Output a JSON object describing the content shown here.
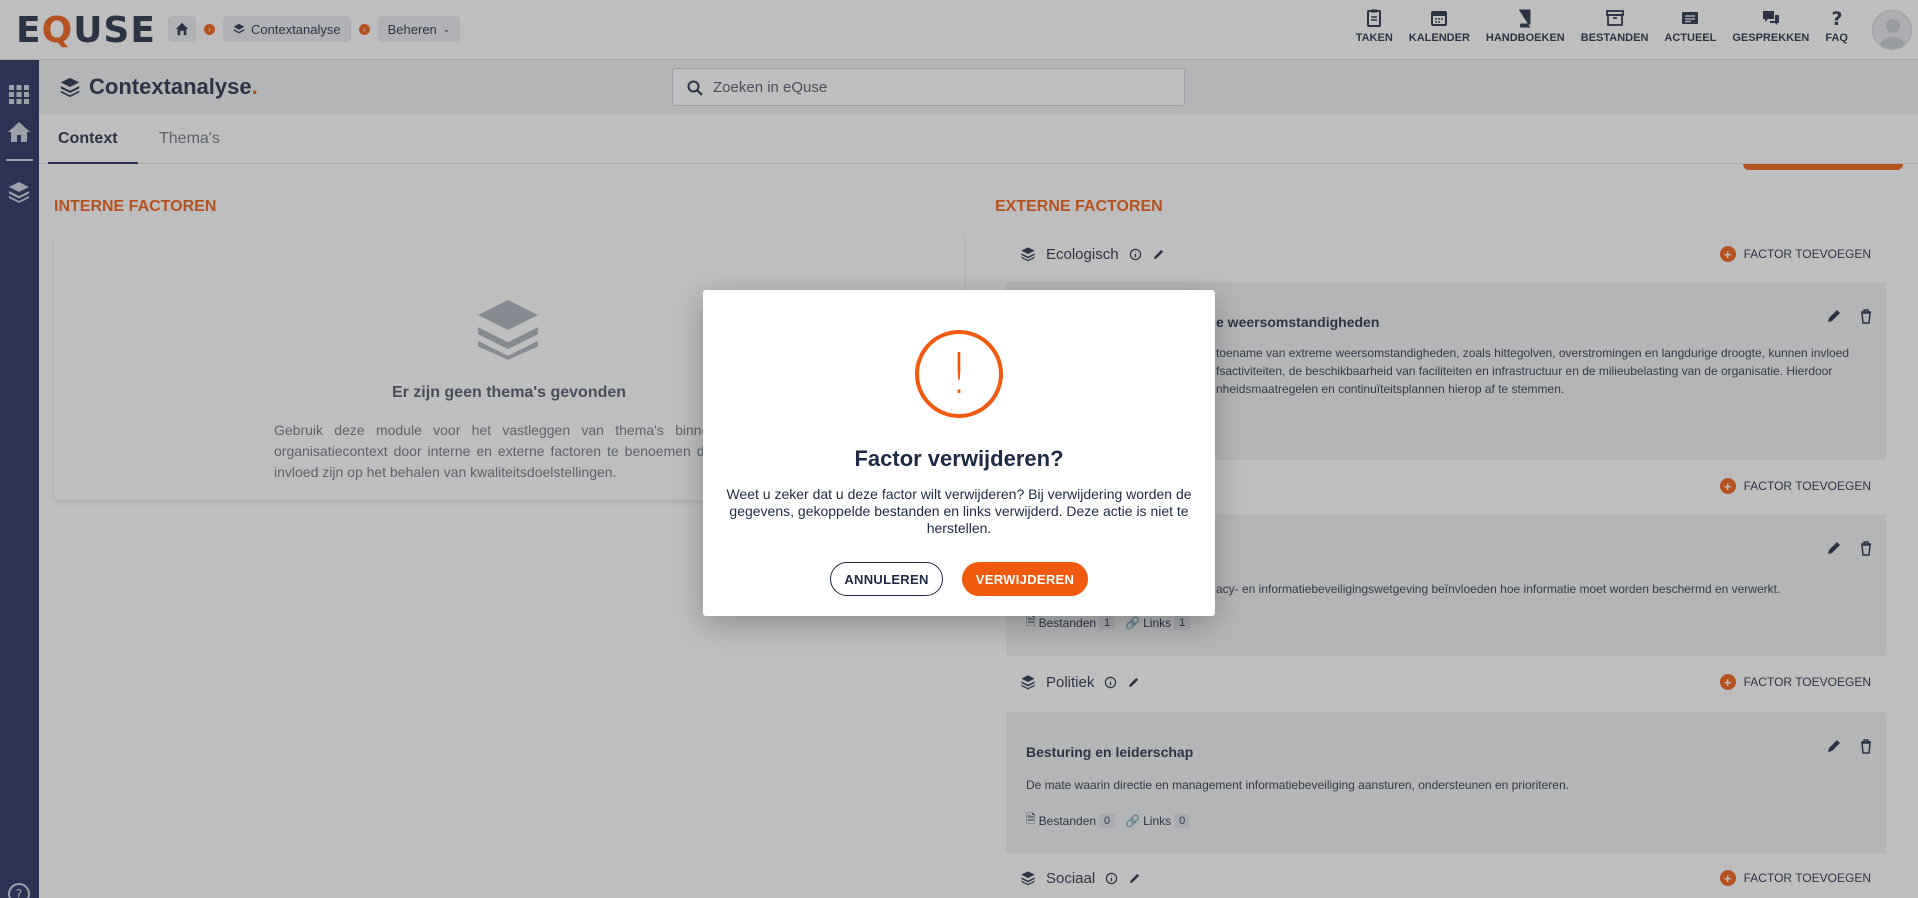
{
  "brand": {
    "logo_pre": "E",
    "logo_q": "Q",
    "logo_post": "USE"
  },
  "breadcrumb": {
    "items": [
      "Contextanalyse",
      "Beheren"
    ]
  },
  "topnav": [
    "TAKEN",
    "KALENDER",
    "HANDBOEKEN",
    "BESTANDEN",
    "ACTUEEL",
    "GESPREKKEN",
    "FAQ"
  ],
  "page": {
    "title": "Contextanalyse",
    "title_dot": "."
  },
  "search": {
    "placeholder": "Zoeken in eQuse"
  },
  "tabs": [
    "Context",
    "Thema's"
  ],
  "internal": {
    "title": "INTERNE FACTOREN",
    "empty_title": "Er zijn geen thema's gevonden",
    "empty_text": "Gebruik deze module voor het vastleggen van thema's binnen de organisatiecontext door interne en externe factoren te benoemen die van invloed zijn op het behalen van kwaliteitsdoelstellingen."
  },
  "external": {
    "title": "EXTERNE FACTOREN",
    "add_label": "FACTOR TOEVOEGEN",
    "categories": [
      {
        "name": "Ecologisch"
      },
      {
        "name": ""
      },
      {
        "name": "Politiek"
      },
      {
        "name": "Sociaal"
      }
    ],
    "factors": [
      {
        "title": "e weersomstandigheden",
        "desc": "toename van extreme weersomstandigheden, zoals hittegolven, overstromingen en langdurige droogte, kunnen invloed fsactiviteiten, de beschikbaarheid van faciliteiten en infrastructuur en de milieubelasting van de organisatie. Hierdoor nheidsmaatregelen en continuïteitsplannen hierop af te stemmen."
      },
      {
        "title": "",
        "desc": "acy- en informatiebeveiligingswetgeving beïnvloeden hoe informatie moet worden beschermd en verwerkt.",
        "files_label": "Bestanden",
        "files": "1",
        "links_label": "Links",
        "links": "1"
      },
      {
        "title": "Besturing en leiderschap",
        "desc": "De mate waarin directie en management informatiebeveiliging aansturen, ondersteunen en prioriteren.",
        "files_label": "Bestanden",
        "files": "0",
        "links_label": "Links",
        "links": "0"
      }
    ]
  },
  "modal": {
    "icon": "!",
    "title": "Factor verwijderen?",
    "text": "Weet u zeker dat u deze factor wilt verwijderen? Bij verwijdering worden de gegevens, gekoppelde bestanden en links verwijderd. Deze actie is niet te herstellen.",
    "cancel": "ANNULEREN",
    "confirm": "VERWIJDEREN"
  },
  "colors": {
    "accent": "#f15a0e",
    "navy": "#1f2a5a"
  }
}
